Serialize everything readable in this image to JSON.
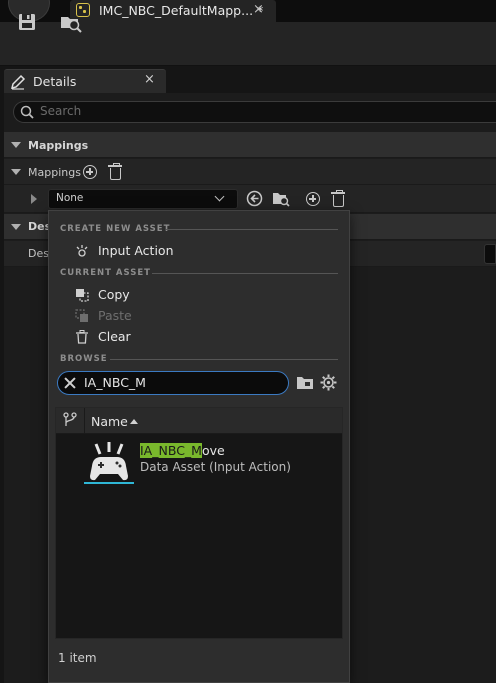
{
  "window": {
    "doc_tab_label": "IMC_NBC_DefaultMapp... *",
    "doc_tab_close": "×"
  },
  "details": {
    "tab_label": "Details",
    "tab_close": "×",
    "search_placeholder": "Search",
    "mappings_category": "Mappings",
    "mappings_property": "Mappings",
    "mapping_value": "None",
    "description_category": "Desc",
    "description_property": "Desc"
  },
  "popup": {
    "create_new_asset_header": "CREATE NEW ASSET",
    "input_action_label": "Input Action",
    "current_asset_header": "CURRENT ASSET",
    "copy_label": "Copy",
    "paste_label": "Paste",
    "clear_label": "Clear",
    "browse_header": "BROWSE",
    "search_value": "IA_NBC_M",
    "name_column": "Name",
    "item_count": "1 item",
    "asset": {
      "name_match": "IA_NBC_M",
      "name_rest": "ove",
      "type": "Data Asset (Input Action)"
    }
  },
  "colors": {
    "accent": "#3b7ac2",
    "highlight": "#79b82c",
    "selection_underline": "#2fb7d6",
    "tab_icon": "#d9c24a"
  },
  "icons": [
    "unreal-logo-icon",
    "data-asset-icon",
    "save-icon",
    "browse-icon",
    "pencil-icon",
    "search-icon",
    "plus-circle-icon",
    "trash-icon",
    "chevron-down-icon",
    "use-selected-icon",
    "browse-asset-icon",
    "input-action-icon",
    "copy-icon",
    "paste-icon",
    "clear-icon",
    "close-icon",
    "folder-icon",
    "settings-icon",
    "branch-icon",
    "gamepad-icon"
  ]
}
